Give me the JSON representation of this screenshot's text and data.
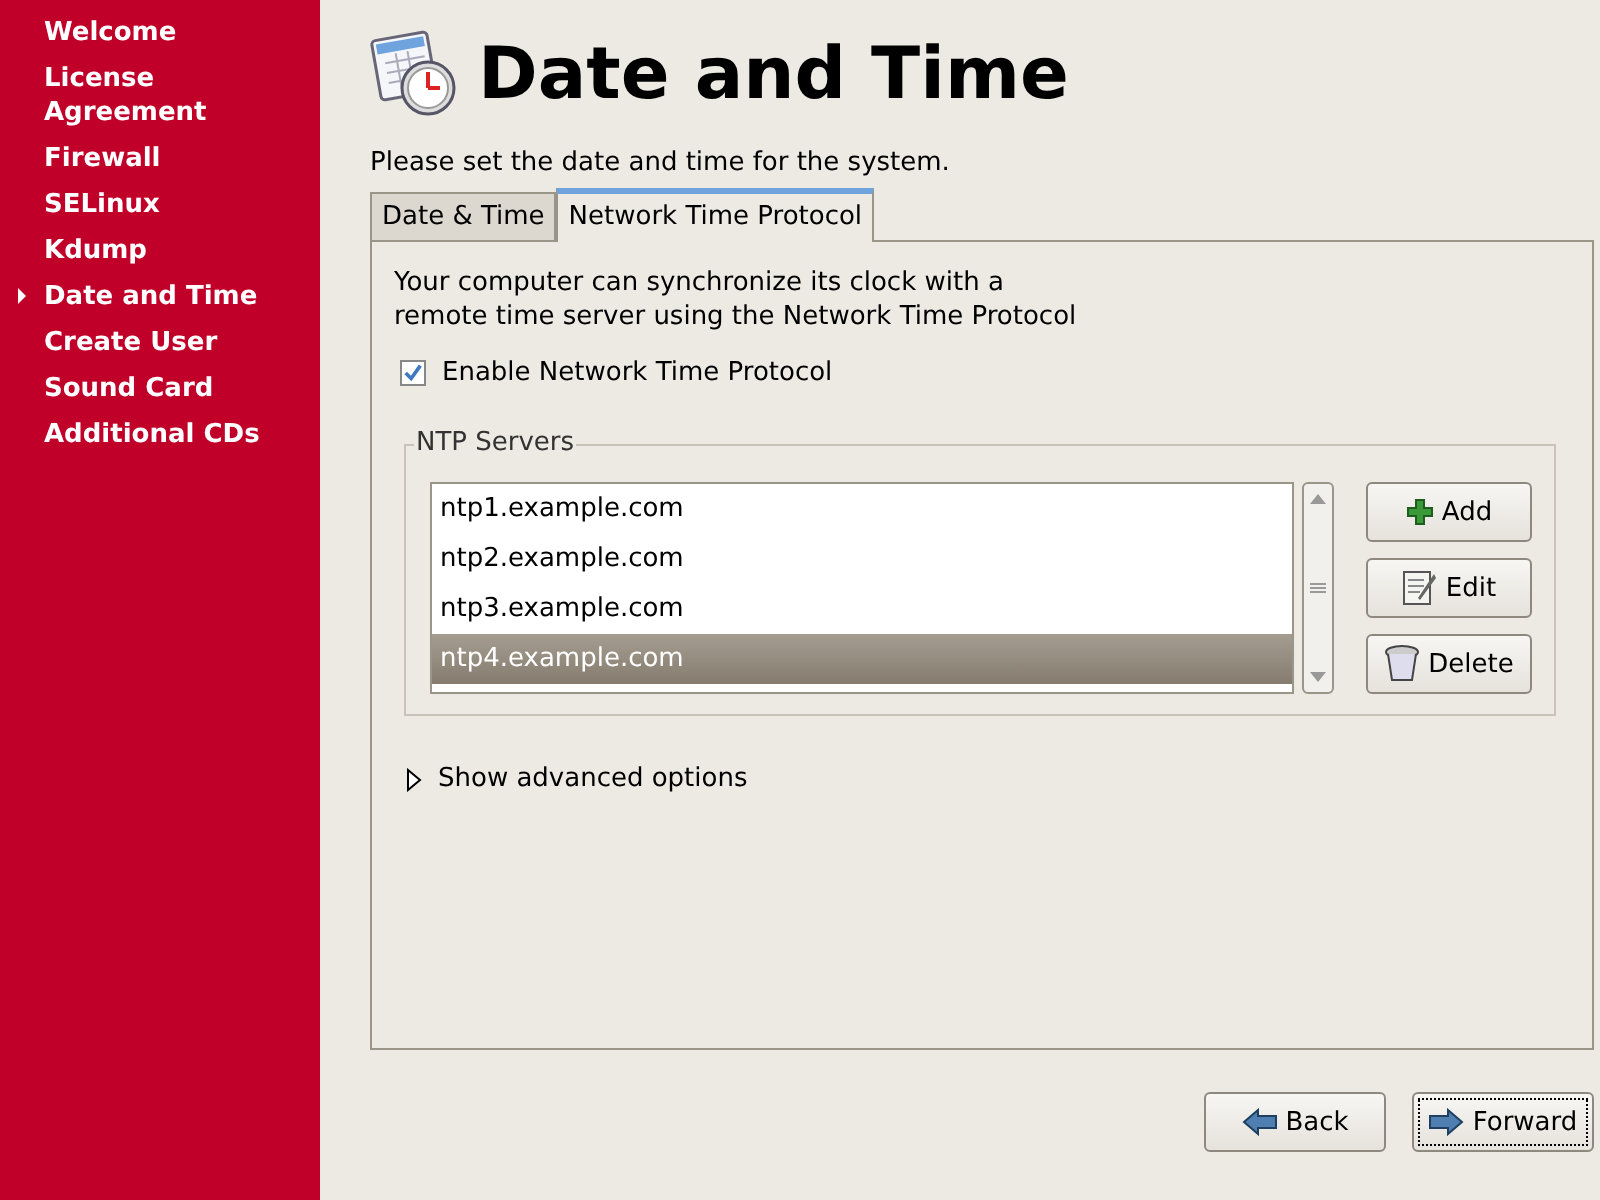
{
  "sidebar": {
    "items": [
      {
        "label": "Welcome",
        "selected": false
      },
      {
        "label": "License Agreement",
        "selected": false
      },
      {
        "label": "Firewall",
        "selected": false
      },
      {
        "label": "SELinux",
        "selected": false
      },
      {
        "label": "Kdump",
        "selected": false
      },
      {
        "label": "Date and Time",
        "selected": true
      },
      {
        "label": "Create User",
        "selected": false
      },
      {
        "label": "Sound Card",
        "selected": false
      },
      {
        "label": "Additional CDs",
        "selected": false
      }
    ]
  },
  "header": {
    "title": "Date and Time",
    "subtitle": "Please set the date and time for the system."
  },
  "tabs": [
    {
      "label": "Date & Time",
      "selected": false
    },
    {
      "label": "Network Time Protocol",
      "selected": true
    }
  ],
  "ntp": {
    "description": "Your computer can synchronize its clock with a\nremote time server using the Network Time Protocol",
    "enable": {
      "label": "Enable Network Time Protocol",
      "checked": true
    },
    "servers": {
      "title": "NTP Servers",
      "rows": [
        {
          "name": "ntp1.example.com",
          "selected": false
        },
        {
          "name": "ntp2.example.com",
          "selected": false
        },
        {
          "name": "ntp3.example.com",
          "selected": false
        },
        {
          "name": "ntp4.example.com",
          "selected": true
        }
      ],
      "buttons": [
        {
          "kind": "add",
          "label": "Add"
        },
        {
          "kind": "edit",
          "label": "Edit"
        },
        {
          "kind": "delete",
          "label": "Delete"
        }
      ]
    },
    "advanced": {
      "label": "Show advanced options",
      "expanded": false
    }
  },
  "footer": {
    "buttons": [
      {
        "kind": "back",
        "label": "Back"
      },
      {
        "kind": "forward",
        "label": "Forward"
      }
    ]
  }
}
